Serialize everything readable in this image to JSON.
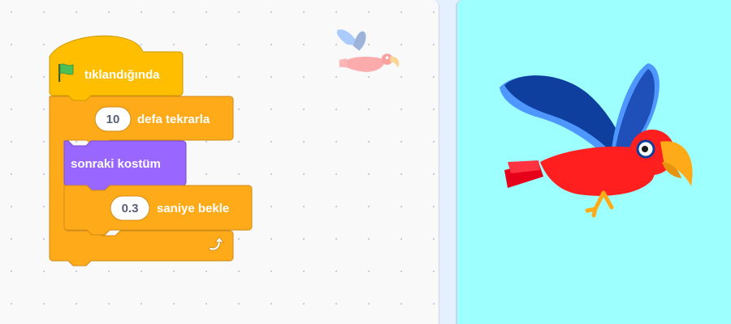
{
  "code_area": {
    "hat_block": {
      "flag_icon": "green-flag-icon",
      "label": "tıklandığında"
    },
    "repeat_block": {
      "count": "10",
      "label": "defa tekrarla",
      "loop_icon": "loop-arrow-icon"
    },
    "next_costume_block": {
      "label": "sonraki kostüm"
    },
    "wait_block": {
      "seconds": "0.3",
      "label": "saniye bekle"
    }
  },
  "sprite": {
    "name_icon": "parrot-sprite-icon"
  },
  "stage": {
    "sprite_icon": "parrot-sprite-icon",
    "background_color": "#9effff"
  },
  "colors": {
    "events": "#ffbf00",
    "control": "#ffab19",
    "looks": "#9966ff",
    "stage_bg": "#9effff"
  }
}
